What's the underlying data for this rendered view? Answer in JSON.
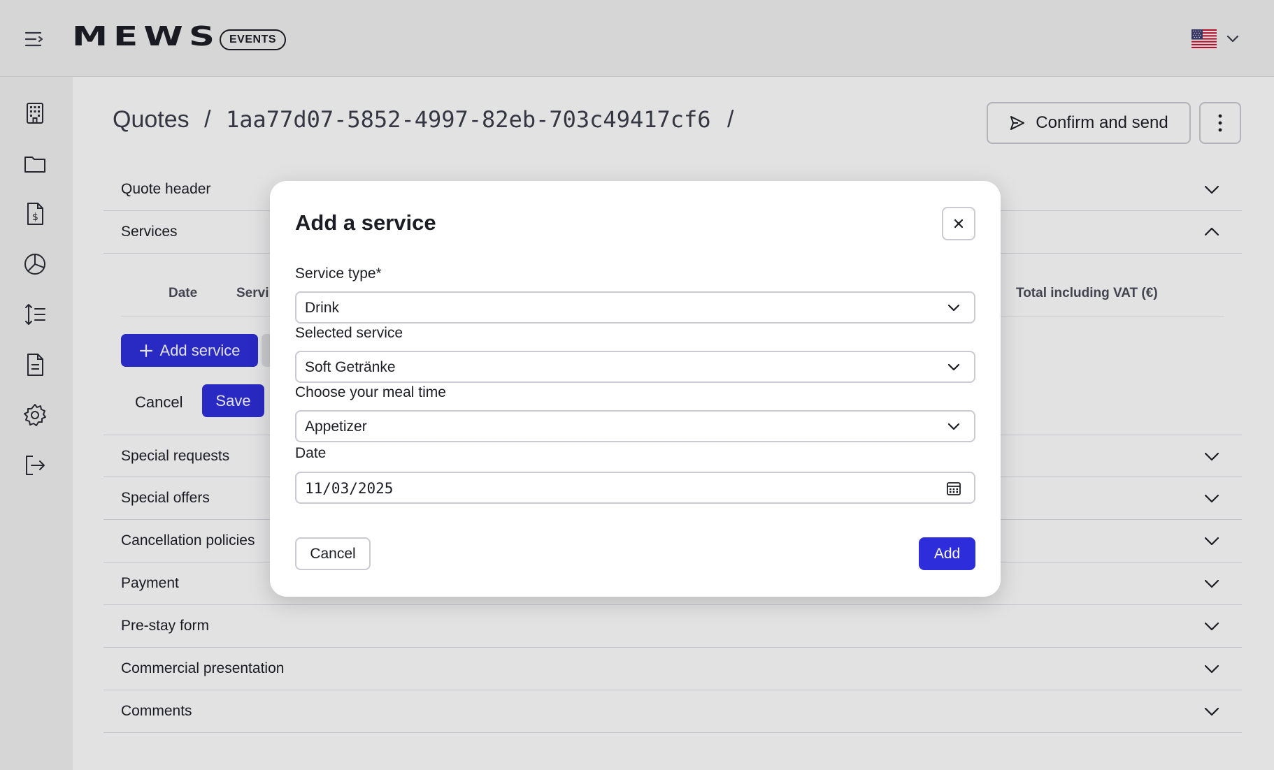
{
  "header": {
    "logo": "MEWS",
    "badge": "EVENTS",
    "language_flag": "us-flag-icon"
  },
  "sidebar": {
    "icons": [
      "building-icon",
      "folder-icon",
      "invoice-icon",
      "pie-chart-icon",
      "sort-list-icon",
      "document-icon",
      "gear-icon",
      "logout-icon"
    ]
  },
  "breadcrumb": {
    "root": "Quotes",
    "sep1": "/",
    "id": "1aa77d07-5852-4997-82eb-703c49417cf6",
    "sep2": "/"
  },
  "actions": {
    "confirm_send": "Confirm and send"
  },
  "sections": {
    "quote_header": "Quote header",
    "services": "Services",
    "special_requests": "Special requests",
    "special_offers": "Special offers",
    "cancellation_policies": "Cancellation policies",
    "payment": "Payment",
    "pre_stay_form": "Pre-stay form",
    "commercial_presentation": "Commercial presentation",
    "comments": "Comments"
  },
  "services_table": {
    "col_date": "Date",
    "col_service": "Servi",
    "col_total": "Total including VAT (€)",
    "add_service": "Add service",
    "cancel": "Cancel",
    "save": "Save"
  },
  "modal": {
    "title": "Add a service",
    "service_type_label": "Service type*",
    "service_type_value": "Drink",
    "selected_service_label": "Selected service",
    "selected_service_value": "Soft Getränke",
    "meal_time_label": "Choose your meal time",
    "meal_time_value": "Appetizer",
    "date_label": "Date",
    "date_value": "11/03/2025",
    "cancel": "Cancel",
    "add": "Add"
  },
  "colors": {
    "accent": "#2d2ddb",
    "topbar_bg": "#f2f2f2",
    "border": "#c9cad2"
  }
}
